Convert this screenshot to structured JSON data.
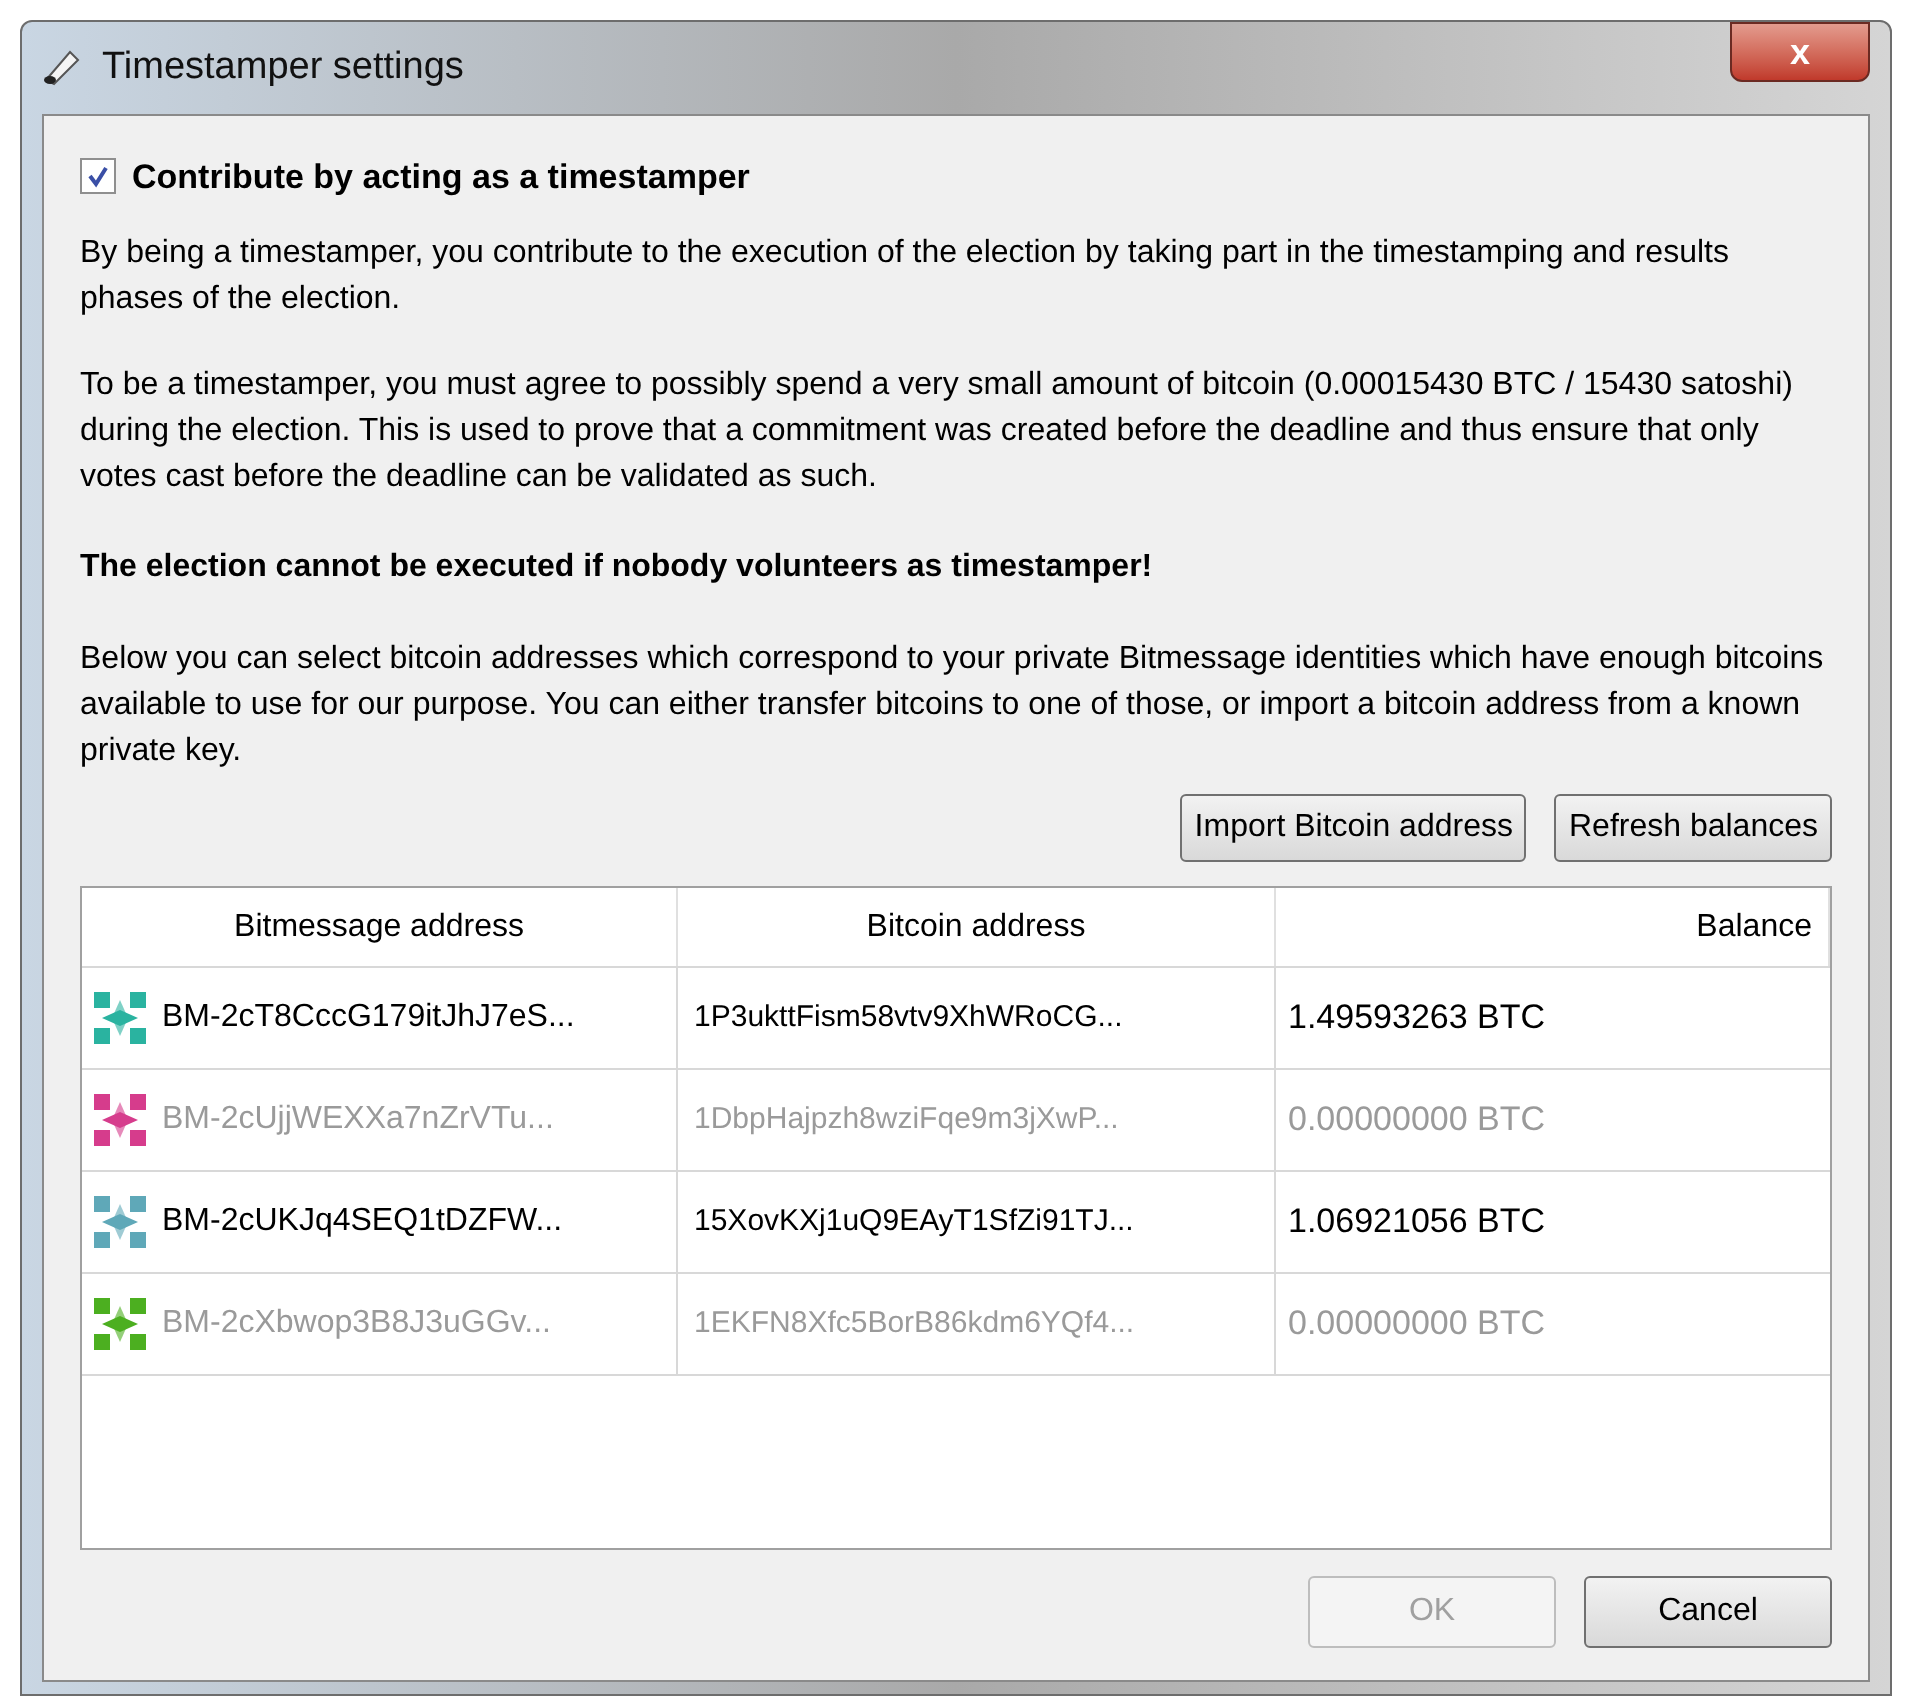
{
  "window": {
    "title": "Timestamper settings",
    "close": "x"
  },
  "contribute": {
    "label": "Contribute by acting as a timestamper",
    "checked": true
  },
  "paragraphs": [
    "By being a timestamper, you contribute to the execution of the election by taking part in the timestamping and results phases of the election.",
    "To be a timestamper, you must agree to possibly spend a very small amount of bitcoin (0.00015430 BTC / 15430 satoshi) during the election. This is used to prove that a commitment was created before the deadline and thus ensure that only votes cast before the deadline can be validated as such."
  ],
  "warning": "The election cannot be executed if nobody volunteers as timestamper!",
  "info": "Below you can select bitcoin addresses which correspond to your private Bitmessage identities which have enough bitcoins available to use for our purpose. You can either transfer bitcoins to one of those, or import a bitcoin address from a known private key.",
  "actions": [
    "Import Bitcoin address",
    "Refresh balances"
  ],
  "table": {
    "columns": [
      "Bitmessage address",
      "Bitcoin address",
      "Balance"
    ],
    "rows": [
      {
        "bitmessage": "BM-2cT8CccG179itJhJ7eS...",
        "bitcoin": "1P3ukttFism58vtv9XhWRoCG...",
        "balance": "1.49593263 BTC",
        "disabled": false,
        "color": "#2ab3a0"
      },
      {
        "bitmessage": "BM-2cUjjWEXXa7nZrVTu...",
        "bitcoin": "1DbpHajpzh8wziFqe9m3jXwP...",
        "balance": "0.00000000 BTC",
        "disabled": true,
        "color": "#d63c8c"
      },
      {
        "bitmessage": "BM-2cUKJq4SEQ1tDZFW...",
        "bitcoin": "15XovKXj1uQ9EAyT1SfZi91TJ...",
        "balance": "1.06921056 BTC",
        "disabled": false,
        "color": "#5fa8b8"
      },
      {
        "bitmessage": "BM-2cXbwop3B8J3uGGv...",
        "bitcoin": "1EKFN8Xfc5BorB86kdm6YQf4...",
        "balance": "0.00000000 BTC",
        "disabled": true,
        "color": "#4caf20"
      }
    ]
  },
  "buttons": [
    {
      "label": "OK",
      "disabled": true
    },
    {
      "label": "Cancel",
      "disabled": false
    }
  ]
}
